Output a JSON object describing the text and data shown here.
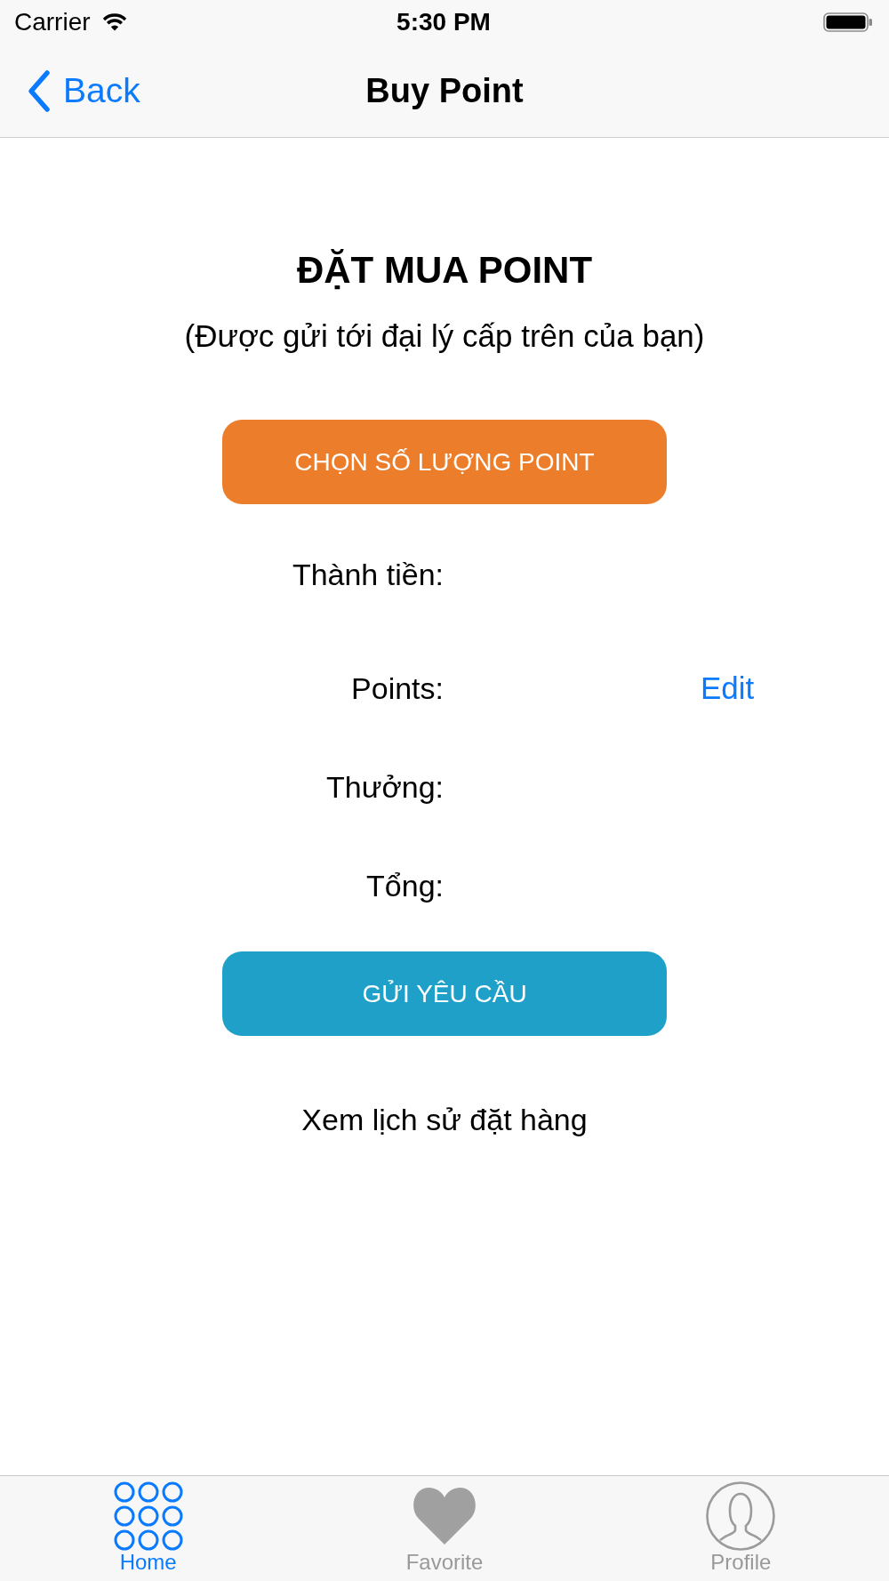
{
  "status_bar": {
    "carrier": "Carrier",
    "time": "5:30 PM"
  },
  "nav_bar": {
    "back": "Back",
    "title": "Buy Point"
  },
  "content": {
    "heading": "ĐẶT MUA POINT",
    "subtitle": "(Được gửi tới đại lý cấp trên của bạn)"
  },
  "quantity_button": {
    "label": "CHỌN SỐ LƯỢNG POINT"
  },
  "summary": [
    {
      "label": "Thành tiền:"
    },
    {
      "label": "Points:",
      "action": "Edit"
    },
    {
      "label": "Thưởng:"
    },
    {
      "label": "Tổng:"
    }
  ],
  "submit_button": {
    "label": "GỬI YÊU CẦU"
  },
  "history_link": "Xem lịch sử đặt hàng",
  "tab_bar": [
    {
      "kind": "grid",
      "label": "Home",
      "selected": true
    },
    {
      "kind": "heart",
      "label": "Favorite",
      "selected": false
    },
    {
      "kind": "person",
      "label": "Profile",
      "selected": false
    }
  ]
}
